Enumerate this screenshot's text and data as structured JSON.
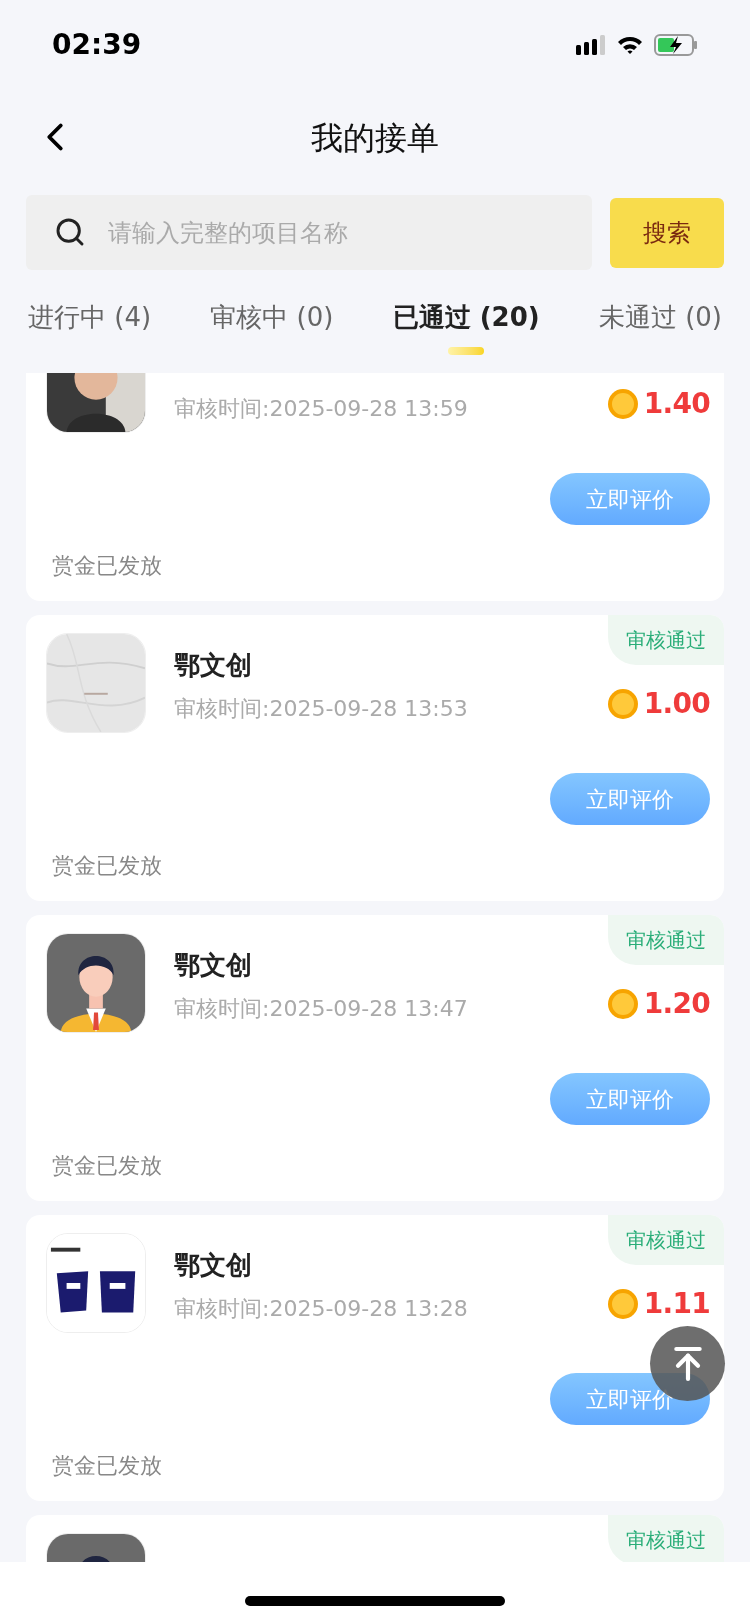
{
  "status_bar": {
    "time": "02:39"
  },
  "header": {
    "title": "我的接单"
  },
  "search": {
    "placeholder": "请输入完整的项目名称",
    "button": "搜索"
  },
  "tabs": [
    {
      "label": "进行中 (4)",
      "selected": false
    },
    {
      "label": "审核中 (0)",
      "selected": false
    },
    {
      "label": "已通过 (20)",
      "selected": true
    },
    {
      "label": "未通过 (0)",
      "selected": false
    }
  ],
  "orders": [
    {
      "time": "审核时间:2025-09-28 13:59",
      "price": "1.40",
      "action": "立即评价",
      "footer": "赏金已发放"
    },
    {
      "avatar": {
        "kind": "marble"
      },
      "badge": "审核通过",
      "title": "鄂文创",
      "time": "审核时间:2025-09-28 13:53",
      "price": "1.00",
      "action": "立即评价",
      "footer": "赏金已发放"
    },
    {
      "avatar": {
        "kind": "person"
      },
      "badge": "审核通过",
      "title": "鄂文创",
      "time": "审核时间:2025-09-28 13:47",
      "price": "1.20",
      "action": "立即评价",
      "footer": "赏金已发放"
    },
    {
      "avatar": {
        "kind": "logo"
      },
      "badge": "审核通过",
      "title": "鄂文创",
      "time": "审核时间:2025-09-28 13:28",
      "price": "1.11",
      "action": "立即评价",
      "footer": "赏金已发放"
    },
    {
      "avatar": {
        "kind": "person"
      },
      "badge": "审核通过"
    }
  ]
}
